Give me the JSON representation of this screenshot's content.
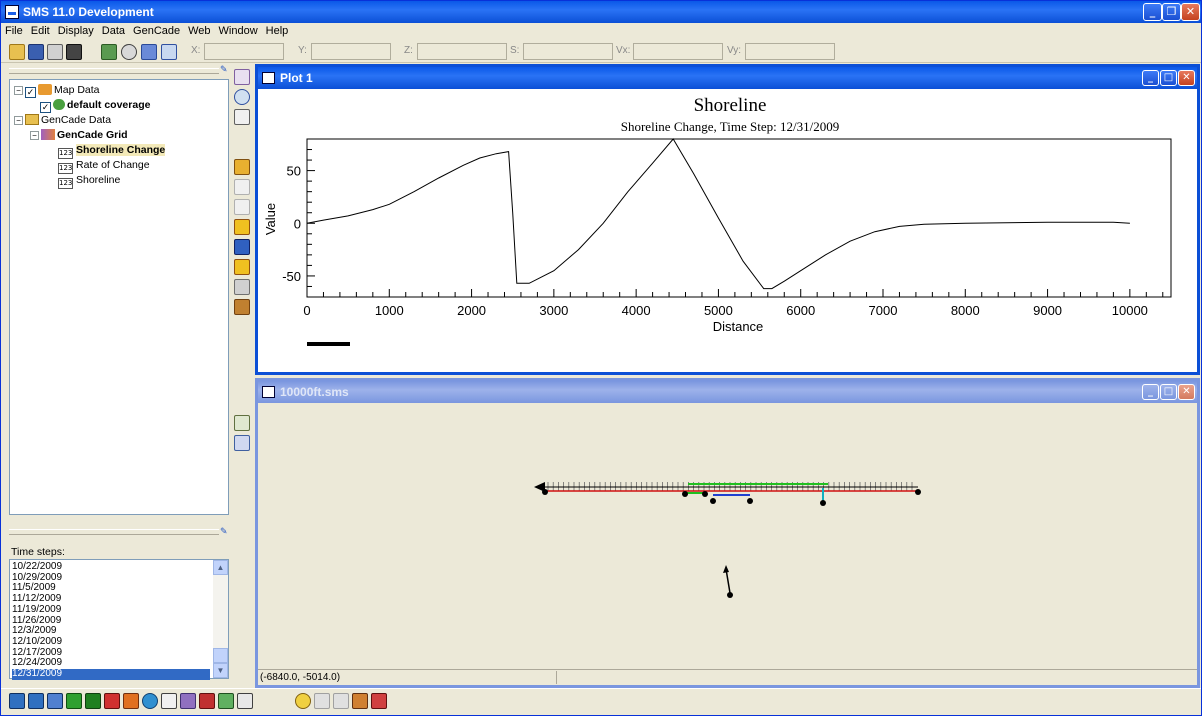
{
  "window": {
    "title": "SMS 11.0 Development"
  },
  "menu": [
    "File",
    "Edit",
    "Display",
    "Data",
    "GenCade",
    "Web",
    "Window",
    "Help"
  ],
  "coords": {
    "x": "X:",
    "y": "Y:",
    "z": "Z:",
    "s": "S:",
    "vx": "Vx:",
    "vy": "Vy:"
  },
  "tree": {
    "map_data": "Map Data",
    "default_coverage": "default coverage",
    "gencade_data": "GenCade Data",
    "gencade_grid": "GenCade Grid",
    "shoreline_change": "Shoreline Change",
    "rate_of_change": "Rate of Change",
    "shoreline": "Shoreline",
    "icon_123": "123"
  },
  "timesteps": {
    "label": "Time steps:",
    "items": [
      "10/22/2009",
      "10/29/2009",
      "11/5/2009",
      "11/12/2009",
      "11/19/2009",
      "11/26/2009",
      "12/3/2009",
      "12/10/2009",
      "12/17/2009",
      "12/24/2009",
      "12/31/2009"
    ],
    "selected": "12/31/2009"
  },
  "plot_window": {
    "title": "Plot 1"
  },
  "map_window": {
    "title": "10000ft.sms",
    "status": "(-6840.0, -5014.0)"
  },
  "chart_data": {
    "type": "line",
    "title": "Shoreline",
    "subtitle": "Shoreline Change, Time Step: 12/31/2009",
    "xlabel": "Distance",
    "ylabel": "Value",
    "xlim": [
      0,
      10500
    ],
    "ylim": [
      -70,
      80
    ],
    "xticks": [
      0,
      1000,
      2000,
      3000,
      4000,
      5000,
      6000,
      7000,
      8000,
      9000,
      10000
    ],
    "yticks": [
      -50,
      0,
      50
    ],
    "grid": false,
    "series": [
      {
        "x": [
          0,
          200,
          500,
          800,
          1000,
          1300,
          1600,
          1900,
          2100,
          2300,
          2450,
          2500,
          2550,
          2700,
          3000,
          3300,
          3600,
          3900,
          4200,
          4450,
          4700,
          5000,
          5300,
          5550,
          5650,
          5800,
          6000,
          6300,
          6600,
          6900,
          7200,
          7500,
          8000,
          9000,
          9800,
          10000
        ],
        "y": [
          0,
          3,
          7,
          13,
          18,
          30,
          43,
          55,
          62,
          66,
          68,
          10,
          -57,
          -57,
          -45,
          -25,
          0,
          30,
          57,
          80,
          47,
          5,
          -36,
          -62,
          -62,
          -55,
          -45,
          -30,
          -17,
          -8,
          -3,
          -1,
          0,
          1,
          1,
          0
        ]
      }
    ]
  }
}
